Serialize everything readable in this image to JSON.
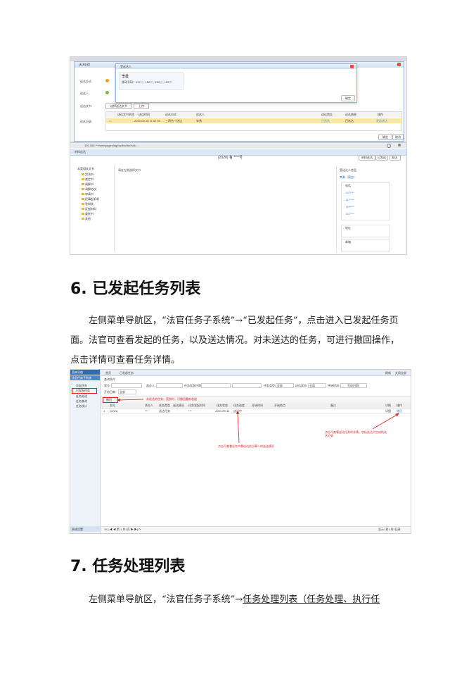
{
  "screenshot1": {
    "dialog_outer_title": "送达处理",
    "dialog_inner_title": "受送达人",
    "labels": {
      "method": "送达方式:",
      "recipient": "送达人:",
      "docs": "送达文书:",
      "record": "送达记录:"
    },
    "popup_name": "李勇",
    "popup_phones": "移动号码：137***, 152***, 139***, 152***",
    "popup_confirm": "确定",
    "choose_doc_btn": "选择送达文书",
    "upload_btn": "上传",
    "record_headers": [
      "送达文书名称",
      "送达时间",
      "送达方式",
      "送达人",
      "送达地址",
      "送达结果",
      "操作"
    ],
    "record_row": {
      "index": "1",
      "time": "2020-09-15 11:57:09",
      "method": "三网合一送达",
      "person": "李勇",
      "address": "已送达",
      "result": "已送达",
      "op": "发起送达"
    },
    "confirm_btn": "确定",
    "cancel_btn": "取消"
  },
  "screenshot2": {
    "url": "192.168.***/web/pages/rjgl/ssdbs/list?sid=...",
    "window_title": "材料送达",
    "case_no": "(2020) 鲁 ****号",
    "right_buttons": [
      "材料送达",
      "已发送",
      "发送"
    ],
    "tree_root": "本案相关文书",
    "tree_items": [
      "判决书",
      "裁定书",
      "调解书",
      "调解协议",
      "申请书",
      "民事起诉状",
      "答辩状",
      "证据材料",
      "委托书",
      "其他"
    ],
    "preview_label": "请在左侧选择文书",
    "recipient_header": "受送达人信息",
    "recipient_name": "李勇（原告）",
    "sub_phone": "电话",
    "sub_address": "地址",
    "sub_email": "邮箱",
    "items": [
      "152****",
      "137****",
      "139****",
      "152****"
    ]
  },
  "section6": {
    "number": "6.",
    "title": "已发起任务列表",
    "para_prefix": "左侧菜单导航区，“法官任务子系统”→“已发起任务”，点击进入已发起任务页面。法官可查看发起的任务，以及送达情况。对未送达的任务，可进行撤回操作，点击详情可查看任务详情。"
  },
  "screenshot3": {
    "menu_title": "菜单导航",
    "menu_sub": "法官任务子系统",
    "menu_items": [
      "发起任务",
      "已发起任务",
      "任务处理",
      "任务查询",
      "任务统计"
    ],
    "tabs": [
      "首页",
      "已发起任务"
    ],
    "tab_right": [
      "刷新",
      "关闭全部"
    ],
    "search_header": "查询条件",
    "filter_labels": [
      "案号:",
      "承办人:",
      "任务发起日期:",
      "任务类型:",
      "送达状态:",
      "开始时间:",
      "开始日期:",
      "完成日期:"
    ],
    "filter_values": [
      "全部",
      "全部",
      "全部"
    ],
    "toolbar_btn": "撤回",
    "annot_withdraw": "未送达的任务，直到时，可撤回重新发起",
    "table_headers": [
      "案号",
      "承办人",
      "任务类型",
      "送达情况",
      "任务发起时间",
      "任务状态",
      "任务进度",
      "开始时间",
      "开始地点",
      "备注",
      "详情",
      "操作"
    ],
    "row": [
      "1",
      "(2020)",
      "***",
      "送达任务",
      "***",
      "2020-09-14",
      "送达中",
      "",
      "",
      "",
      "详细",
      "撤回"
    ],
    "annot_detail": "点击可查看送达任务的详情，包括送达中生成的送达记录",
    "annot_status": "点击可查看任务中需送达的当事人的送达情况",
    "bottom_left": "系统设置",
    "pager": "15  |  ◀  ◀  第 1 共1页  ▶  ▶|  ⟳",
    "pager_right": "显示1到1,共1记录"
  },
  "section7": {
    "number": "7.",
    "title": "任务处理列表",
    "para_prefix": "左侧菜单导航区，“法官任务子系统”→",
    "para_underlined": "任务处理列表（任务处理、执行任"
  }
}
